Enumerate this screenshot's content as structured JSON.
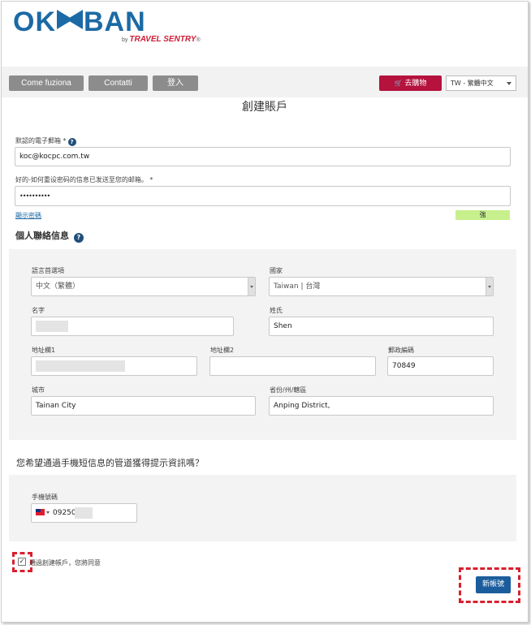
{
  "brand": {
    "name": "OK",
    "name_end": "BAN",
    "by": "by",
    "partner": "TRAVEL SENTRY",
    "reg": "®"
  },
  "nav": {
    "how_it_works": "Come fuziona",
    "contacts": "Contatti",
    "login": "登入",
    "cart": "去購物",
    "language": "TW - 繁體中文"
  },
  "page": {
    "title": "創建賬戶"
  },
  "account": {
    "email_label": "默認的電子郵箱 *",
    "email_value": "koc@kocpc.com.tw",
    "password_label": "好的-如何重设密码的信息已发送至您的邮箱。 *",
    "password_value": "••••••••••",
    "show_password": "顯示密碼",
    "strength": "強"
  },
  "contact": {
    "title": "個人聯絡信息",
    "language_label": "語言首選項",
    "language_value": "中文（繁體）",
    "country_label": "國家",
    "country_value": "Taiwan | 台灣",
    "first_name_label": "名字",
    "first_name_value": "",
    "last_name_label": "姓氏",
    "last_name_value": "Shen",
    "address1_label": "地址欄1",
    "address1_value": "",
    "address2_label": "地址欄2",
    "address2_value": "",
    "postal_label": "郵政編碼",
    "postal_value": "70849",
    "city_label": "城市",
    "city_value": "Tainan City",
    "state_label": "省份/州/轄區",
    "state_value": "Anping District,"
  },
  "sms": {
    "question": "您希望通過手機短信息的管道獲得提示資訊嗎？",
    "phone_label": "手機號碼",
    "phone_value": "09250"
  },
  "terms": {
    "checked": "✓",
    "agree_text": "通過創建帳戶，您將同意"
  },
  "submit": {
    "label": "新帳號"
  },
  "icons": {
    "help": "?",
    "cart": "🛒"
  },
  "colors": {
    "brand_blue": "#1b6aa5",
    "cart_red": "#b5123e",
    "strength_green": "#c7f08c",
    "highlight_red": "#d8202e"
  }
}
